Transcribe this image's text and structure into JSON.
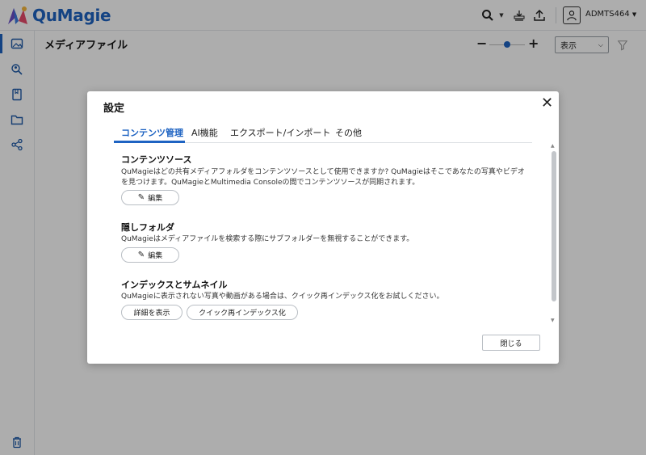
{
  "app": {
    "name": "QuMagie",
    "brand_color": "#1e63c2"
  },
  "topbar": {
    "icons": [
      "search-icon",
      "upload-queue-icon",
      "upload-icon"
    ],
    "user": {
      "name": "ADMTS464"
    }
  },
  "sidebar": {
    "items": [
      "photos-icon",
      "search-person-icon",
      "album-icon",
      "folder-icon",
      "share-icon"
    ],
    "bottom": "trash-icon"
  },
  "main": {
    "title": "メディアファイル",
    "zoom": {
      "minus": "−",
      "plus": "+"
    },
    "view_select": "表示"
  },
  "modal": {
    "title": "設定",
    "tabs": [
      "コンテンツ管理",
      "AI機能",
      "エクスポート/インポート",
      "その他"
    ],
    "active_tab": 0,
    "sections": {
      "content_source": {
        "title": "コンテンツソース",
        "desc": "QuMagieはどの共有メディアフォルダをコンテンツソースとして使用できますか? QuMagieはそこであなたの写真やビデオを見つけます。QuMagieとMultimedia Consoleの間でコンテンツソースが同期されます。",
        "button": "編集"
      },
      "hidden_folder": {
        "title": "隠しフォルダ",
        "desc": "QuMagieはメディアファイルを検索する際にサブフォルダーを無視することができます。",
        "button": "編集"
      },
      "index": {
        "title": "インデックスとサムネイル",
        "desc": "QuMagieに表示されない写真や動画がある場合は、クイック再インデックス化をお試しください。",
        "button_details": "詳細を表示",
        "button_reindex": "クイック再インデックス化"
      }
    },
    "close_button": "閉じる"
  }
}
